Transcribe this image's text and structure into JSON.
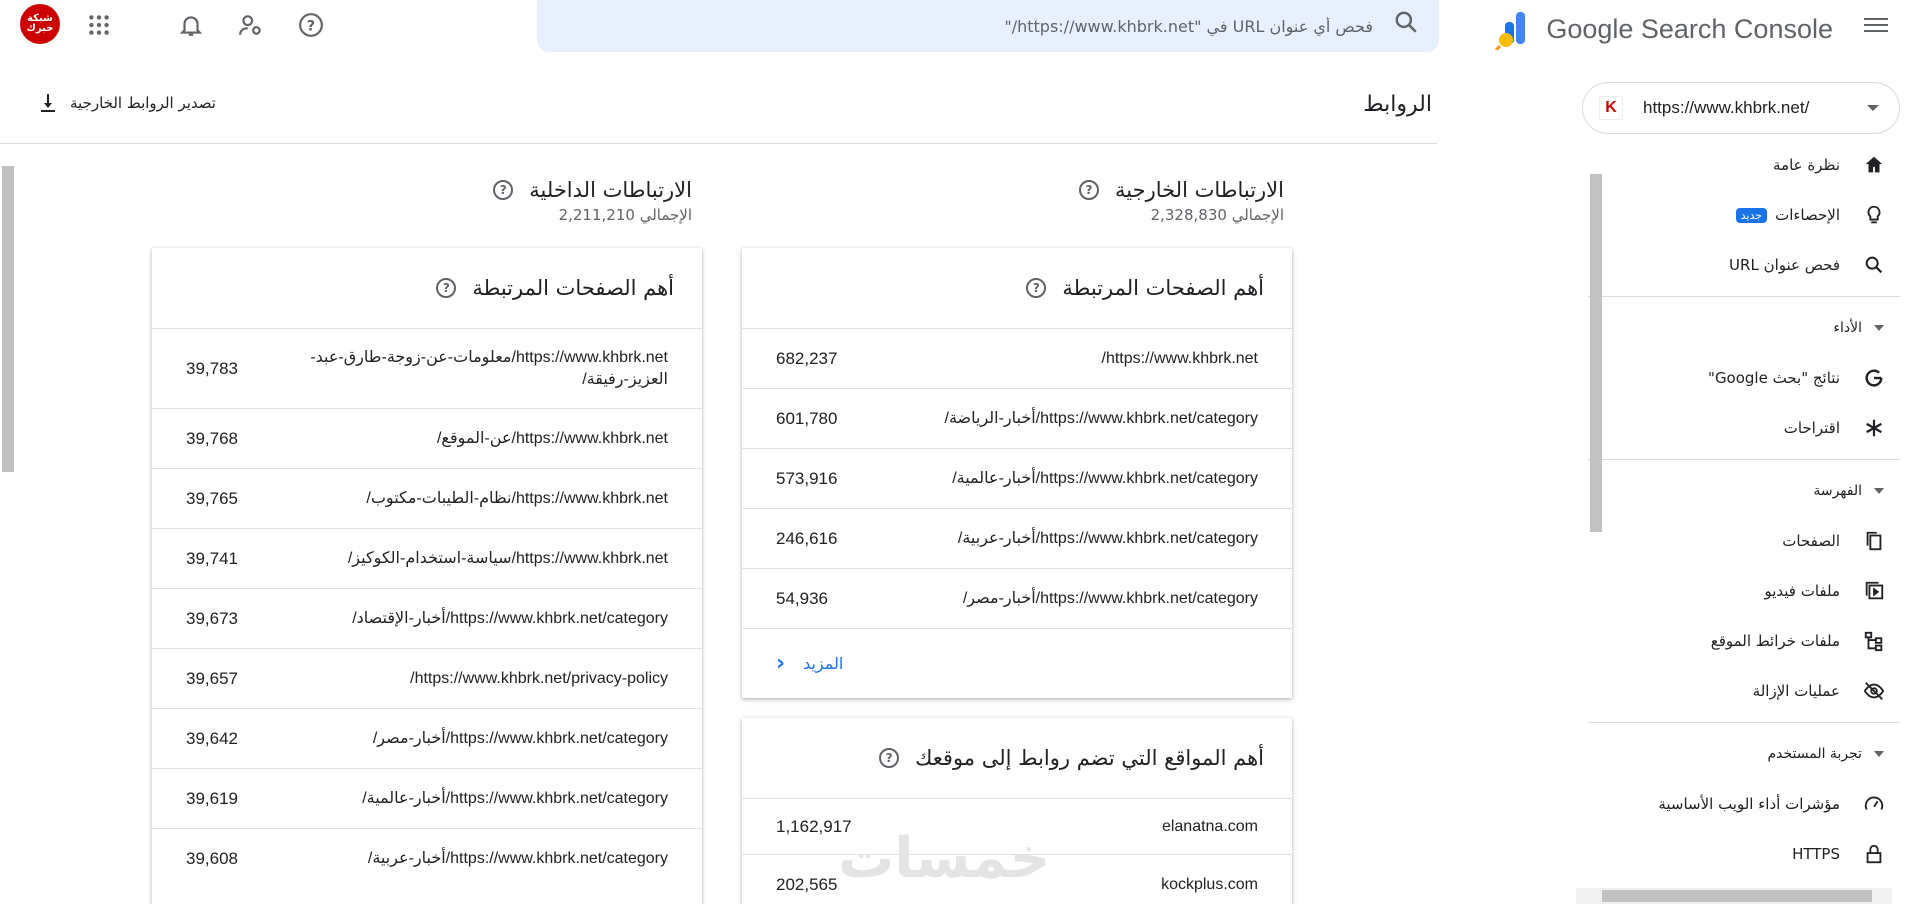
{
  "header": {
    "brand": "Google Search Console",
    "search_placeholder": "فحص أي عنوان URL في \"https://www.khbrk.net/\"",
    "site_logo_text": "شبكة خبرك"
  },
  "property": {
    "url": "https://www.khbrk.net/",
    "favicon": "K"
  },
  "sidebar": {
    "items_top": [
      {
        "label": "نظرة عامة",
        "icon": "home-icon"
      },
      {
        "label": "الإحصاءات",
        "icon": "lightbulb-icon",
        "badge": "جديد"
      },
      {
        "label": "فحص عنوان URL",
        "icon": "search-icon"
      }
    ],
    "section_performance": "الأداء",
    "items_performance": [
      {
        "label": "نتائج \"بحث Google\"",
        "icon": "google-g-icon"
      },
      {
        "label": "اقتراحات",
        "icon": "asterisk-icon"
      }
    ],
    "section_indexing": "الفهرسة",
    "items_indexing": [
      {
        "label": "الصفحات",
        "icon": "pages-icon"
      },
      {
        "label": "ملفات فيديو",
        "icon": "video-icon"
      },
      {
        "label": "ملفات خرائط الموقع",
        "icon": "sitemap-icon"
      },
      {
        "label": "عمليات الإزالة",
        "icon": "eye-off-icon"
      }
    ],
    "section_experience": "تجربة المستخدم",
    "items_experience": [
      {
        "label": "مؤشرات أداء الويب الأساسية",
        "icon": "gauge-icon"
      },
      {
        "label": "HTTPS",
        "icon": "lock-icon"
      }
    ]
  },
  "main": {
    "title": "الروابط",
    "export_label": "تصدير الروابط الخارجية",
    "external": {
      "title": "الارتباطات الخارجية",
      "total": "الإجمالي 2,328,830",
      "top_pages_title": "أهم الصفحات المرتبطة",
      "top_pages": [
        {
          "url": "https://www.khbrk.net/",
          "count": "682,237"
        },
        {
          "url": "https://www.khbrk.net/category/أخبار-الرياضة/",
          "count": "601,780"
        },
        {
          "url": "https://www.khbrk.net/category/أخبار-عالمية/",
          "count": "573,916"
        },
        {
          "url": "https://www.khbrk.net/category/أخبار-عربية/",
          "count": "246,616"
        },
        {
          "url": "https://www.khbrk.net/category/أخبار-مصر/",
          "count": "54,936"
        }
      ],
      "more_label": "المزيد",
      "top_sites_title": "أهم المواقع التي تضم روابط إلى موقعك",
      "top_sites": [
        {
          "url": "elanatna.com",
          "count": "1,162,917"
        },
        {
          "url": "kockplus.com",
          "count": "202,565"
        }
      ]
    },
    "internal": {
      "title": "الارتباطات الداخلية",
      "total": "الإجمالي 2,211,210",
      "top_pages_title": "أهم الصفحات المرتبطة",
      "top_pages": [
        {
          "url": "https://www.khbrk.net/معلومات-عن-زوجة-طارق-عبد-العزيز-رفيقة/",
          "count": "39,783"
        },
        {
          "url": "https://www.khbrk.net/عن-الموقع/",
          "count": "39,768"
        },
        {
          "url": "https://www.khbrk.net/نظام-الطيبات-مكتوب/",
          "count": "39,765"
        },
        {
          "url": "https://www.khbrk.net/سياسة-استخدام-الكوكيز/",
          "count": "39,741"
        },
        {
          "url": "https://www.khbrk.net/category/أخبار-الإقتصاد/",
          "count": "39,673"
        },
        {
          "url": "https://www.khbrk.net/privacy-policy/",
          "count": "39,657"
        },
        {
          "url": "https://www.khbrk.net/category/أخبار-مصر/",
          "count": "39,642"
        },
        {
          "url": "https://www.khbrk.net/category/أخبار-عالمية/",
          "count": "39,619"
        },
        {
          "url": "https://www.khbrk.net/category/أخبار-عربية/",
          "count": "39,608"
        }
      ]
    }
  },
  "watermark": "خمسات",
  "colors": {
    "accent": "#1a73e8",
    "text": "#202124",
    "muted": "#5f6368",
    "search_bg": "#e8f0fe"
  }
}
